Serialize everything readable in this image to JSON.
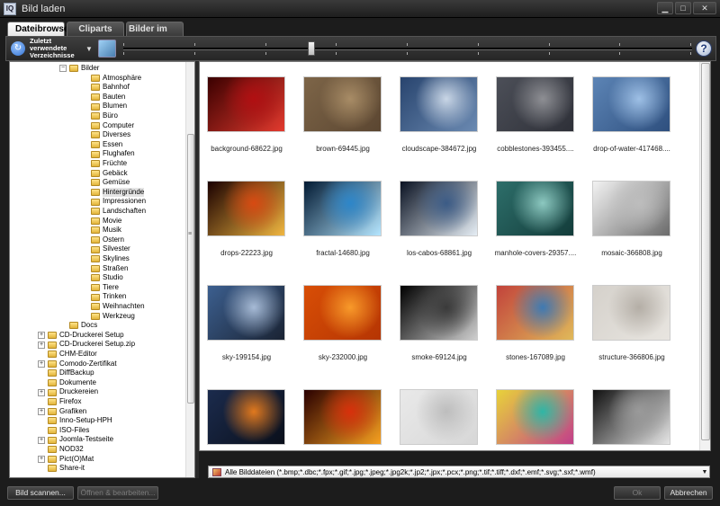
{
  "window": {
    "title": "Bild laden",
    "app_icon": "IQ",
    "buttons": [
      "▁",
      "□",
      "✕"
    ]
  },
  "tabs": [
    "Dateibrowser",
    "Cliparts",
    "Bilder im Internet"
  ],
  "active_tab": 0,
  "toolbar": {
    "recent_dirs_label": "Zuletzt verwendete Verzeichnisse",
    "help_label": "?",
    "thumbnail_size_fraction": 0.33
  },
  "tree": {
    "items": [
      {
        "label": "Bilder",
        "level": 3,
        "expander": "−"
      },
      {
        "label": "Atmosphäre",
        "level": 4
      },
      {
        "label": "Bahnhof",
        "level": 4
      },
      {
        "label": "Bauten",
        "level": 4
      },
      {
        "label": "Blumen",
        "level": 4
      },
      {
        "label": "Büro",
        "level": 4
      },
      {
        "label": "Computer",
        "level": 4
      },
      {
        "label": "Diverses",
        "level": 4
      },
      {
        "label": "Essen",
        "level": 4
      },
      {
        "label": "Flughafen",
        "level": 4
      },
      {
        "label": "Früchte",
        "level": 4
      },
      {
        "label": "Gebäck",
        "level": 4
      },
      {
        "label": "Gemüse",
        "level": 4
      },
      {
        "label": "Hintergründe",
        "level": 4,
        "selected": true
      },
      {
        "label": "Impressionen",
        "level": 4
      },
      {
        "label": "Landschaften",
        "level": 4
      },
      {
        "label": "Movie",
        "level": 4
      },
      {
        "label": "Musik",
        "level": 4
      },
      {
        "label": "Ostern",
        "level": 4
      },
      {
        "label": "Silvester",
        "level": 4
      },
      {
        "label": "Skylines",
        "level": 4
      },
      {
        "label": "Straßen",
        "level": 4
      },
      {
        "label": "Studio",
        "level": 4
      },
      {
        "label": "Tiere",
        "level": 4
      },
      {
        "label": "Trinken",
        "level": 4
      },
      {
        "label": "Weihnachten",
        "level": 4
      },
      {
        "label": "Werkzeug",
        "level": 4
      },
      {
        "label": "Docs",
        "level": 3
      },
      {
        "label": "CD-Druckerei Setup",
        "level": 1,
        "expander": "+"
      },
      {
        "label": "CD-Druckerei Setup.zip",
        "level": 1,
        "expander": "+"
      },
      {
        "label": "CHM-Editor",
        "level": 1
      },
      {
        "label": "Comodo-Zertifikat",
        "level": 1,
        "expander": "+"
      },
      {
        "label": "DiffBackup",
        "level": 1
      },
      {
        "label": "Dokumente",
        "level": 1
      },
      {
        "label": "Druckereien",
        "level": 1,
        "expander": "+"
      },
      {
        "label": "Firefox",
        "level": 1
      },
      {
        "label": "Grafiken",
        "level": 1,
        "expander": "+"
      },
      {
        "label": "Inno-Setup-HPH",
        "level": 1
      },
      {
        "label": "ISO-Files",
        "level": 1
      },
      {
        "label": "Joomla-Testseite",
        "level": 1,
        "expander": "+"
      },
      {
        "label": "NOD32",
        "level": 1
      },
      {
        "label": "Pict(O)Mat",
        "level": 1,
        "expander": "+"
      },
      {
        "label": "Share-it",
        "level": 1
      }
    ]
  },
  "images": [
    {
      "caption": "background-68622.jpg",
      "palette": [
        "#3a0000",
        "#b10f12",
        "#e33a2e"
      ]
    },
    {
      "caption": "brown-69445.jpg",
      "palette": [
        "#7d6548",
        "#a88c66",
        "#5b4631"
      ]
    },
    {
      "caption": "cloudscape-384672.jpg",
      "palette": [
        "#28446e",
        "#c9d6e6",
        "#6b8ab2"
      ]
    },
    {
      "caption": "cobblestones-393455....",
      "palette": [
        "#4c4f58",
        "#8e8f94",
        "#2e3038"
      ]
    },
    {
      "caption": "drop-of-water-417468....",
      "palette": [
        "#5c84b5",
        "#9ec0e6",
        "#2e4f7e"
      ]
    },
    {
      "caption": "drops-22223.jpg",
      "palette": [
        "#1a0000",
        "#d84a12",
        "#f0b640"
      ]
    },
    {
      "caption": "fractal-14680.jpg",
      "palette": [
        "#021a33",
        "#2d86c9",
        "#b5e6ff"
      ]
    },
    {
      "caption": "los-cabos-68861.jpg",
      "palette": [
        "#0a1222",
        "#3b5b86",
        "#e6eef5"
      ]
    },
    {
      "caption": "manhole-covers-29357....",
      "palette": [
        "#2d6e6a",
        "#8cc8c0",
        "#133c3a"
      ]
    },
    {
      "caption": "mosaic-366808.jpg",
      "palette": [
        "#f2f2f2",
        "#bdbdbd",
        "#6b6b6b"
      ]
    },
    {
      "caption": "sky-199154.jpg",
      "palette": [
        "#3c5f8f",
        "#a7bbd6",
        "#1a2333"
      ]
    },
    {
      "caption": "sky-232000.jpg",
      "palette": [
        "#d84e06",
        "#f89a2a",
        "#b53503"
      ]
    },
    {
      "caption": "smoke-69124.jpg",
      "palette": [
        "#000000",
        "#3a3a3a",
        "#cfcfcf"
      ]
    },
    {
      "caption": "stones-167089.jpg",
      "palette": [
        "#c2433b",
        "#3e7ab3",
        "#e0b95a"
      ]
    },
    {
      "caption": "structure-366806.jpg",
      "palette": [
        "#d5d1cb",
        "#b4aea6",
        "#e8e5e0"
      ]
    },
    {
      "caption": "",
      "palette": [
        "#1b2b4d",
        "#e1791e",
        "#0a0f1a"
      ]
    },
    {
      "caption": "",
      "palette": [
        "#2a0000",
        "#d8300c",
        "#f6a020"
      ]
    },
    {
      "caption": "",
      "palette": [
        "#e9e9e9",
        "#bdbdbd",
        "#d7d7d7"
      ]
    },
    {
      "caption": "",
      "palette": [
        "#e8d23a",
        "#2fb6a6",
        "#c23f8a"
      ]
    },
    {
      "caption": "",
      "palette": [
        "#101010",
        "#9a9a9a",
        "#e6e6e6"
      ]
    }
  ],
  "filter": {
    "label": "Alle Bilddateien (*.bmp;*.dbc;*.fpx;*.gif;*.jpg;*.jpeg;*.jpg2k;*.jp2;*.jpx;*.pcx;*.png;*.tif;*.tiff;*.dxf;*.emf;*.svg;*.sxf;*.wmf)"
  },
  "bottom_buttons": {
    "scan": "Bild scannen...",
    "open_edit": "Öffnen & bearbeiten...",
    "ok": "Ok",
    "cancel": "Abbrechen"
  },
  "colors": {
    "chrome_dark": "#1c1c1c",
    "tab_active": "#ffffff",
    "selection": "#e4e4e4"
  }
}
